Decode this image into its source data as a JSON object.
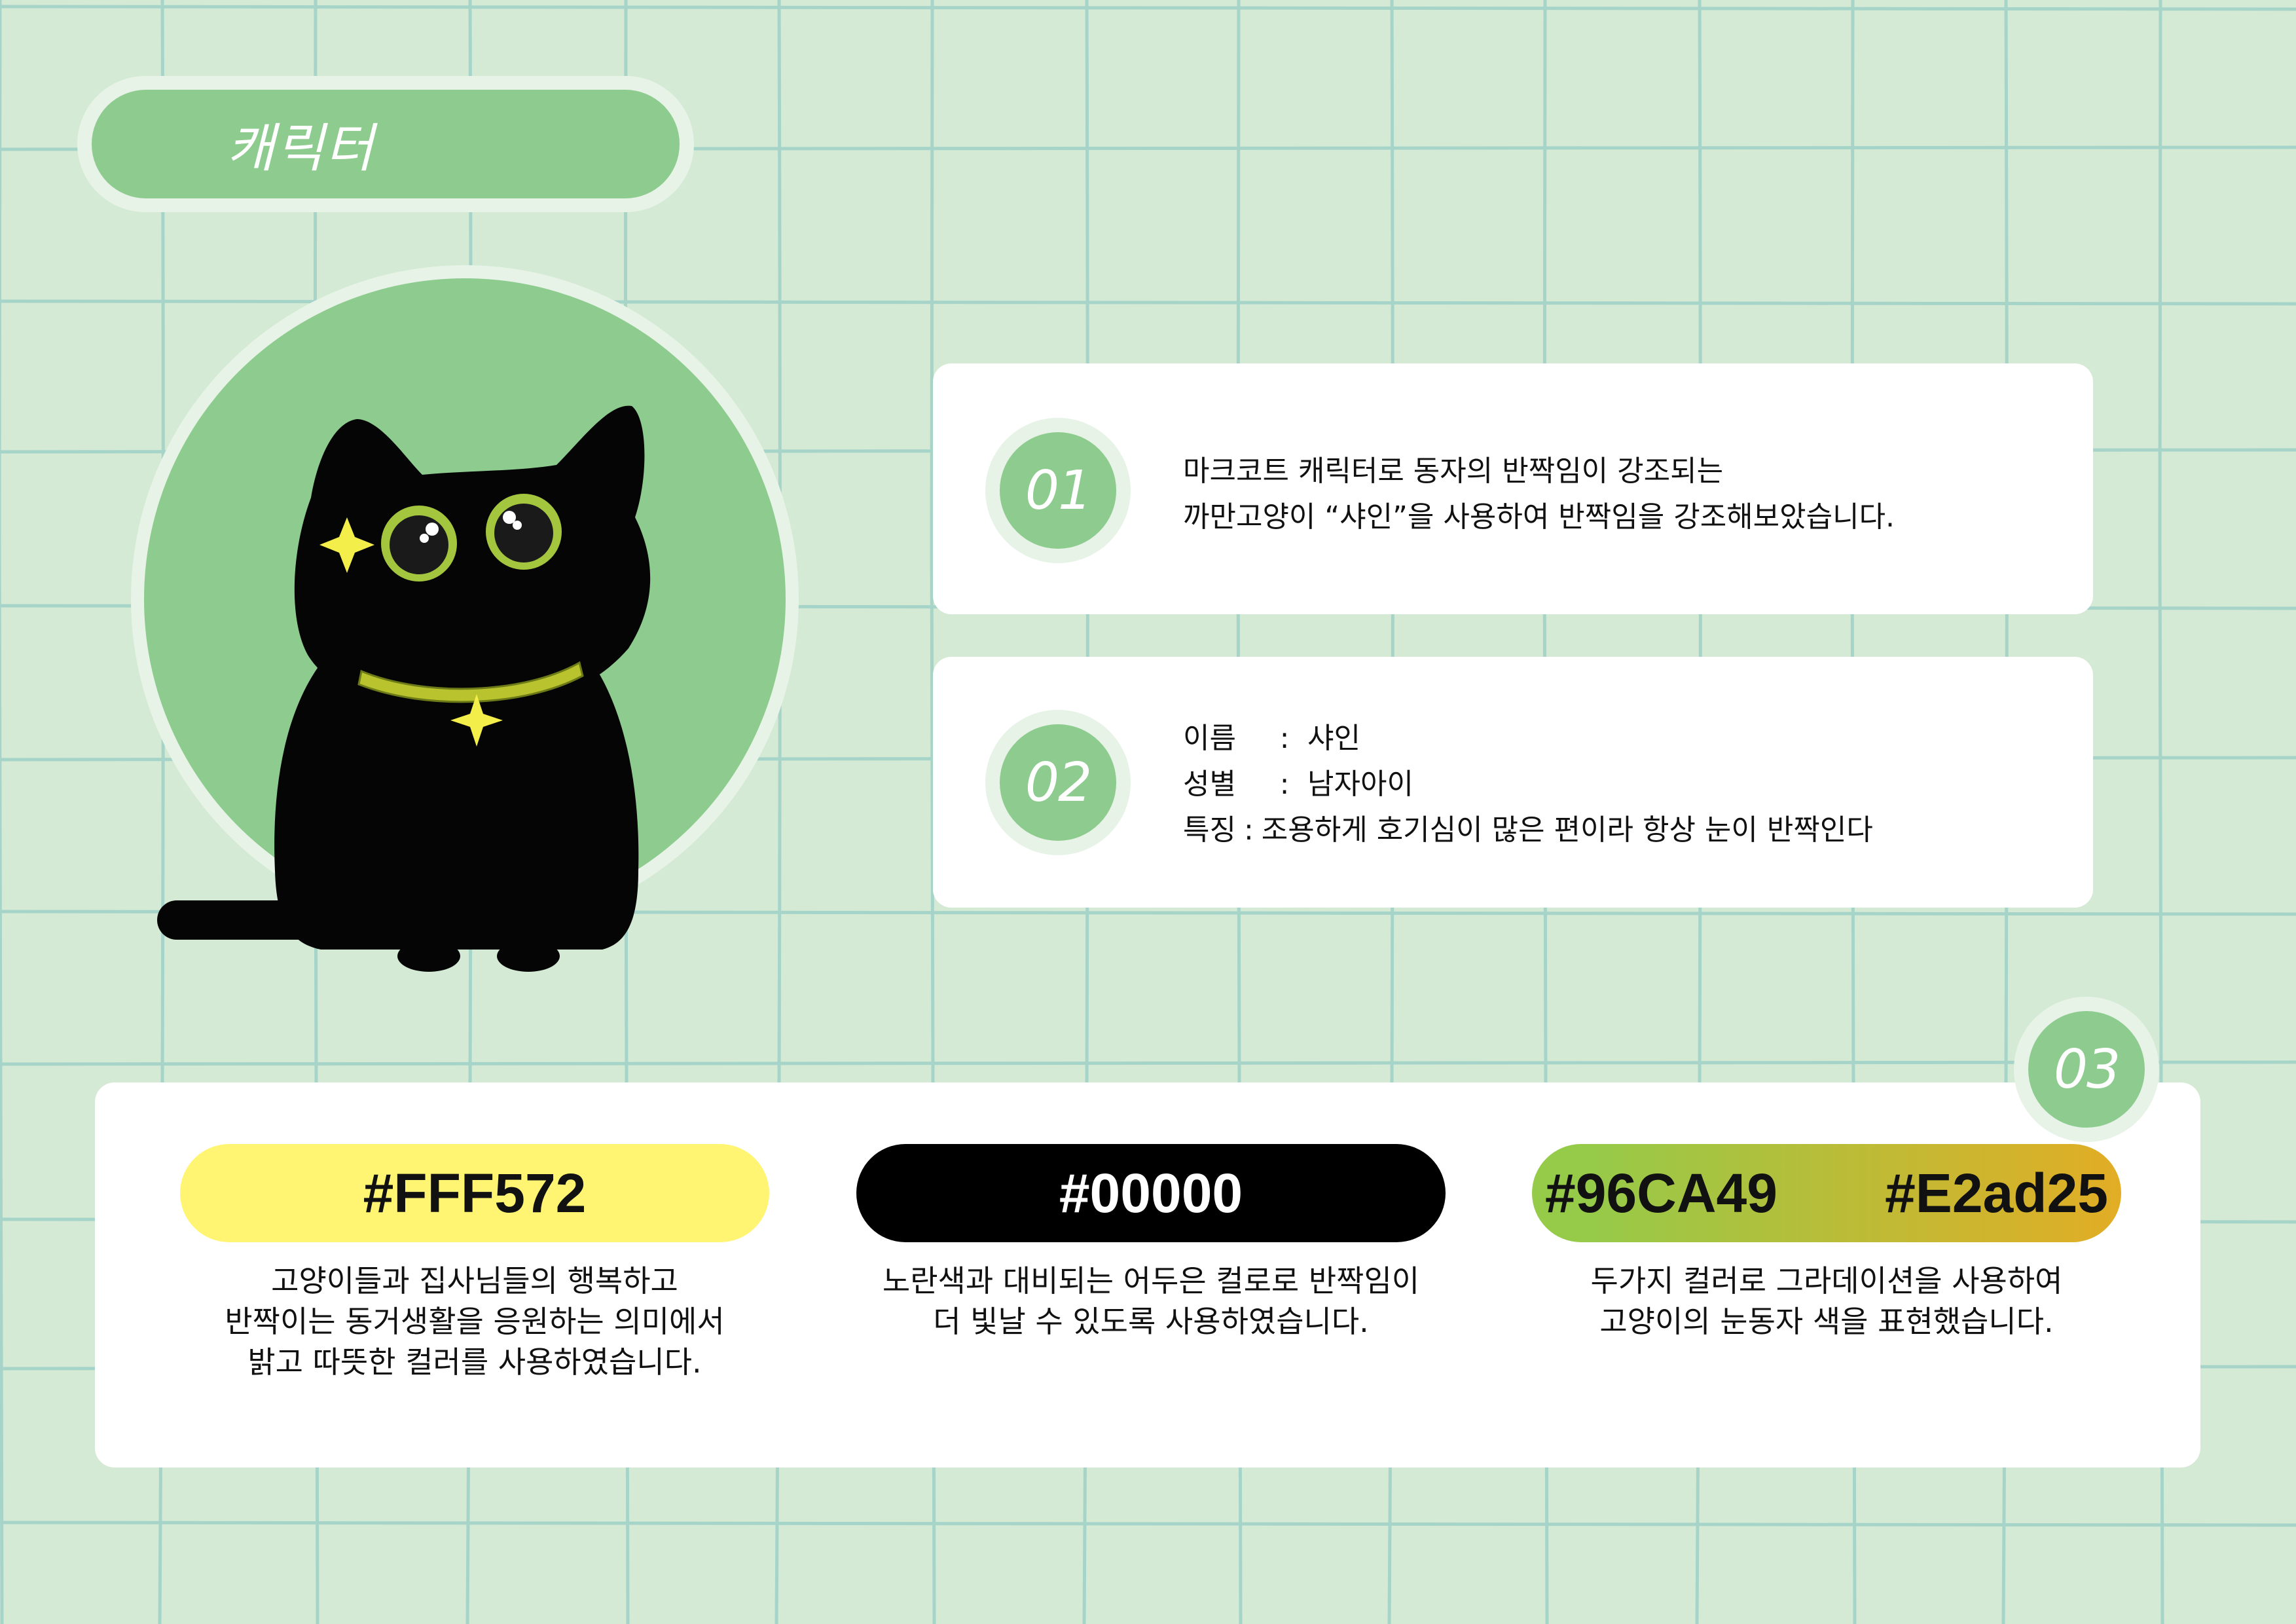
{
  "header": {
    "title": "캐릭터"
  },
  "items": [
    {
      "number": "01",
      "lines": [
        "마크코트 캐릭터로 동자의 반짝임이 강조되는",
        "까만고양이 “샤인”을 사용하여 반짝임을 강조해보았습니다."
      ]
    },
    {
      "number": "02",
      "profile": [
        {
          "key": "이름",
          "sep": ":",
          "value": "샤인"
        },
        {
          "key": "성별",
          "sep": ":",
          "value": "남자아이"
        },
        {
          "key": "특징",
          "sep": ":",
          "value": "조용하게 호기심이 많은 편이라 항상 눈이 반짝인다"
        }
      ]
    },
    {
      "number": "03"
    }
  ],
  "palette": [
    {
      "label": "#FFF572",
      "color": "#fff572",
      "caption": [
        "고양이들과 집사님들의 행복하고",
        "반짝이는 동거생활을 응원하는 의미에서",
        "밝고 따뜻한 컬러를 사용하였습니다."
      ]
    },
    {
      "label": "#00000",
      "color": "#000000",
      "caption": [
        "노란색과 대비되는 어두은 컬로로 반짝임이",
        "더 빛날 수 있도록 사용하였습니다."
      ]
    },
    {
      "labels": [
        "#96CA49",
        "#E2ad25"
      ],
      "colors": [
        "#96ca49",
        "#e2ad25"
      ],
      "caption": [
        "두가지 컬러로 그라데이션을 사용하여",
        "고양이의 눈동자 색을 표현했습니다."
      ]
    }
  ],
  "colors": {
    "background": "#d4ead5",
    "accent": "#8ecb8f",
    "grid": "#9fd0c8"
  }
}
